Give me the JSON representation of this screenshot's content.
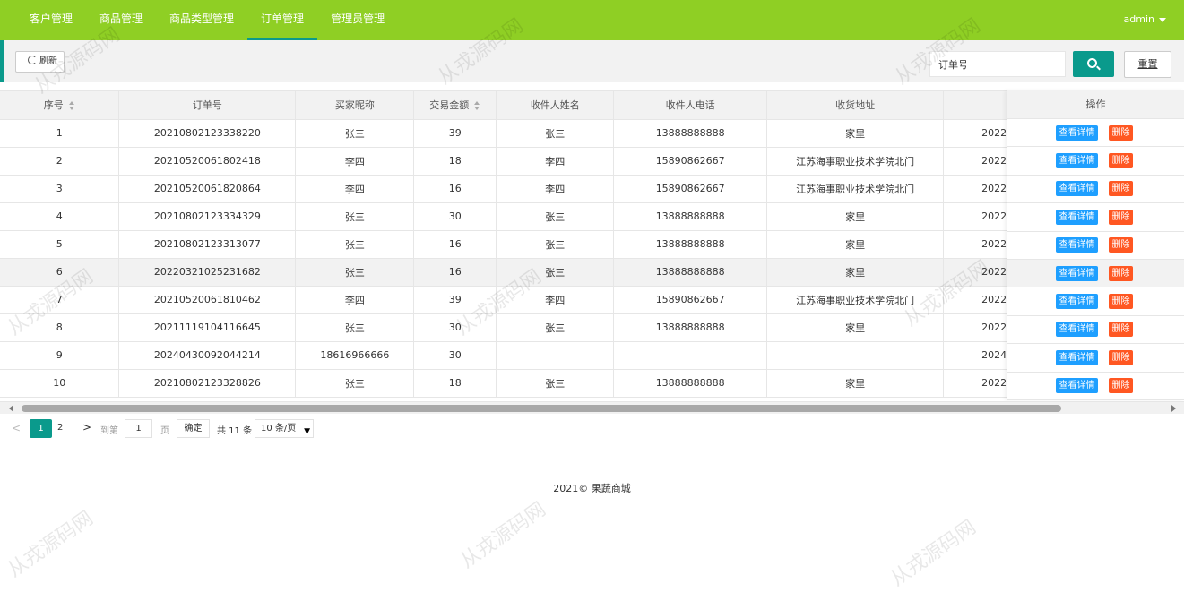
{
  "nav": {
    "items": [
      "客户管理",
      "商品管理",
      "商品类型管理",
      "订单管理",
      "管理员管理"
    ],
    "active_index": 3,
    "user": "admin"
  },
  "toolbar": {
    "refresh_label": "刷新",
    "search_value": "订单号",
    "reset_label": "重置"
  },
  "table": {
    "headers": [
      "序号",
      "订单号",
      "买家昵称",
      "交易金额",
      "收件人姓名",
      "收件人电话",
      "收货地址",
      ""
    ],
    "action_header": "操作",
    "detail_label": "查看详情",
    "delete_label": "删除",
    "rows": [
      [
        "1",
        "20210802123338220",
        "张三",
        "39",
        "张三",
        "13888888888",
        "家里",
        "2022-"
      ],
      [
        "2",
        "20210520061802418",
        "李四",
        "18",
        "李四",
        "15890862667",
        "江苏海事职业技术学院北门",
        "2022-"
      ],
      [
        "3",
        "20210520061820864",
        "李四",
        "16",
        "李四",
        "15890862667",
        "江苏海事职业技术学院北门",
        "2022-"
      ],
      [
        "4",
        "20210802123334329",
        "张三",
        "30",
        "张三",
        "13888888888",
        "家里",
        "2022-"
      ],
      [
        "5",
        "20210802123313077",
        "张三",
        "16",
        "张三",
        "13888888888",
        "家里",
        "2022-"
      ],
      [
        "6",
        "20220321025231682",
        "张三",
        "16",
        "张三",
        "13888888888",
        "家里",
        "2022-"
      ],
      [
        "7",
        "20210520061810462",
        "李四",
        "39",
        "李四",
        "15890862667",
        "江苏海事职业技术学院北门",
        "2022-"
      ],
      [
        "8",
        "20211119104116645",
        "张三",
        "30",
        "张三",
        "13888888888",
        "家里",
        "2022-"
      ],
      [
        "9",
        "20240430092044214",
        "18616966666",
        "30",
        "",
        "",
        "",
        "2024-"
      ],
      [
        "10",
        "20210802123328826",
        "张三",
        "18",
        "张三",
        "13888888888",
        "家里",
        "2022-"
      ]
    ],
    "highlight_row": 5
  },
  "pager": {
    "prev": "<",
    "page1": "1",
    "page2": "2",
    "next": ">",
    "goto_label": "到第",
    "goto_value": "1",
    "page_word": "页",
    "confirm_label": "确定",
    "total": "共 11 条",
    "page_size": "10 条/页"
  },
  "footer": "2021© 果蔬商城",
  "watermark": "从戎源码网",
  "colors": {
    "topbar": "#8fcf24",
    "accent": "#0a9a8c",
    "detail": "#1e9fff",
    "delete": "#ff5722"
  }
}
